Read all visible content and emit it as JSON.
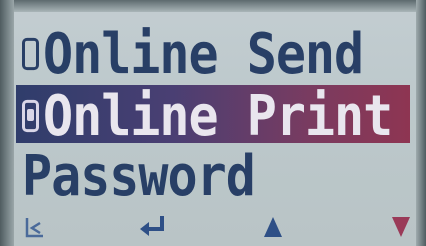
{
  "menu": {
    "items": [
      {
        "label": "Online Send",
        "radio": "unchecked",
        "selected": false
      },
      {
        "label": "Online Print",
        "radio": "checked",
        "selected": true
      },
      {
        "label": "Password",
        "radio": "none",
        "selected": false
      }
    ]
  },
  "softkeys": [
    {
      "icon": "back-icon"
    },
    {
      "icon": "enter-icon"
    },
    {
      "icon": "up-arrow-icon"
    },
    {
      "icon": "down-arrow-icon"
    }
  ],
  "colors": {
    "screen_bg": "#bfcacd",
    "text": "#283f66",
    "highlight_start": "#2f3d6b",
    "highlight_end": "#8e3552",
    "highlight_text": "#e9e6ee",
    "down_arrow": "#9a3a58"
  }
}
